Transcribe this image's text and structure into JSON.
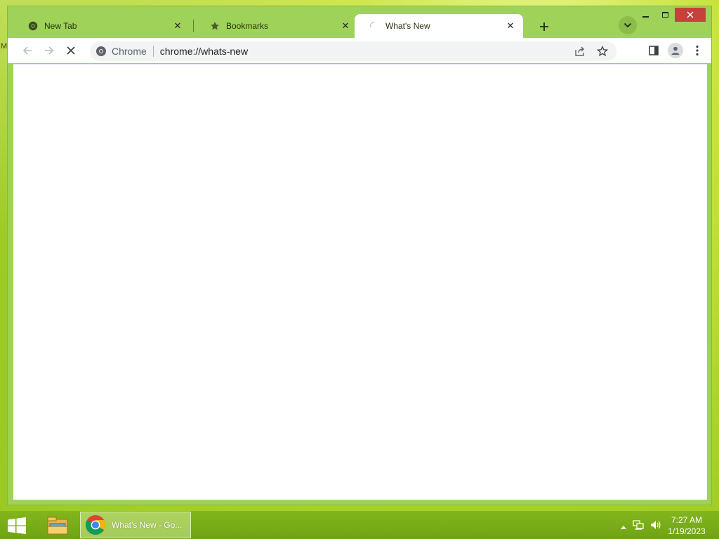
{
  "browser": {
    "tabs": [
      {
        "title": "New Tab",
        "icon": "chrome-icon",
        "active": false
      },
      {
        "title": "Bookmarks",
        "icon": "star-icon",
        "active": false
      },
      {
        "title": "What's New",
        "icon": "loading-spinner-icon",
        "active": true
      }
    ],
    "omnibox": {
      "chip_label": "Chrome",
      "url": "chrome://whats-new"
    }
  },
  "desktop": {
    "edge_glyph": "M"
  },
  "taskbar": {
    "active_app_label": "What's New - Go...",
    "clock_time": "7:27 AM",
    "clock_date": "1/19/2023"
  },
  "colors": {
    "frame": "#9fd259",
    "close_button": "#c7413b",
    "taskbar": "#7aae18"
  }
}
